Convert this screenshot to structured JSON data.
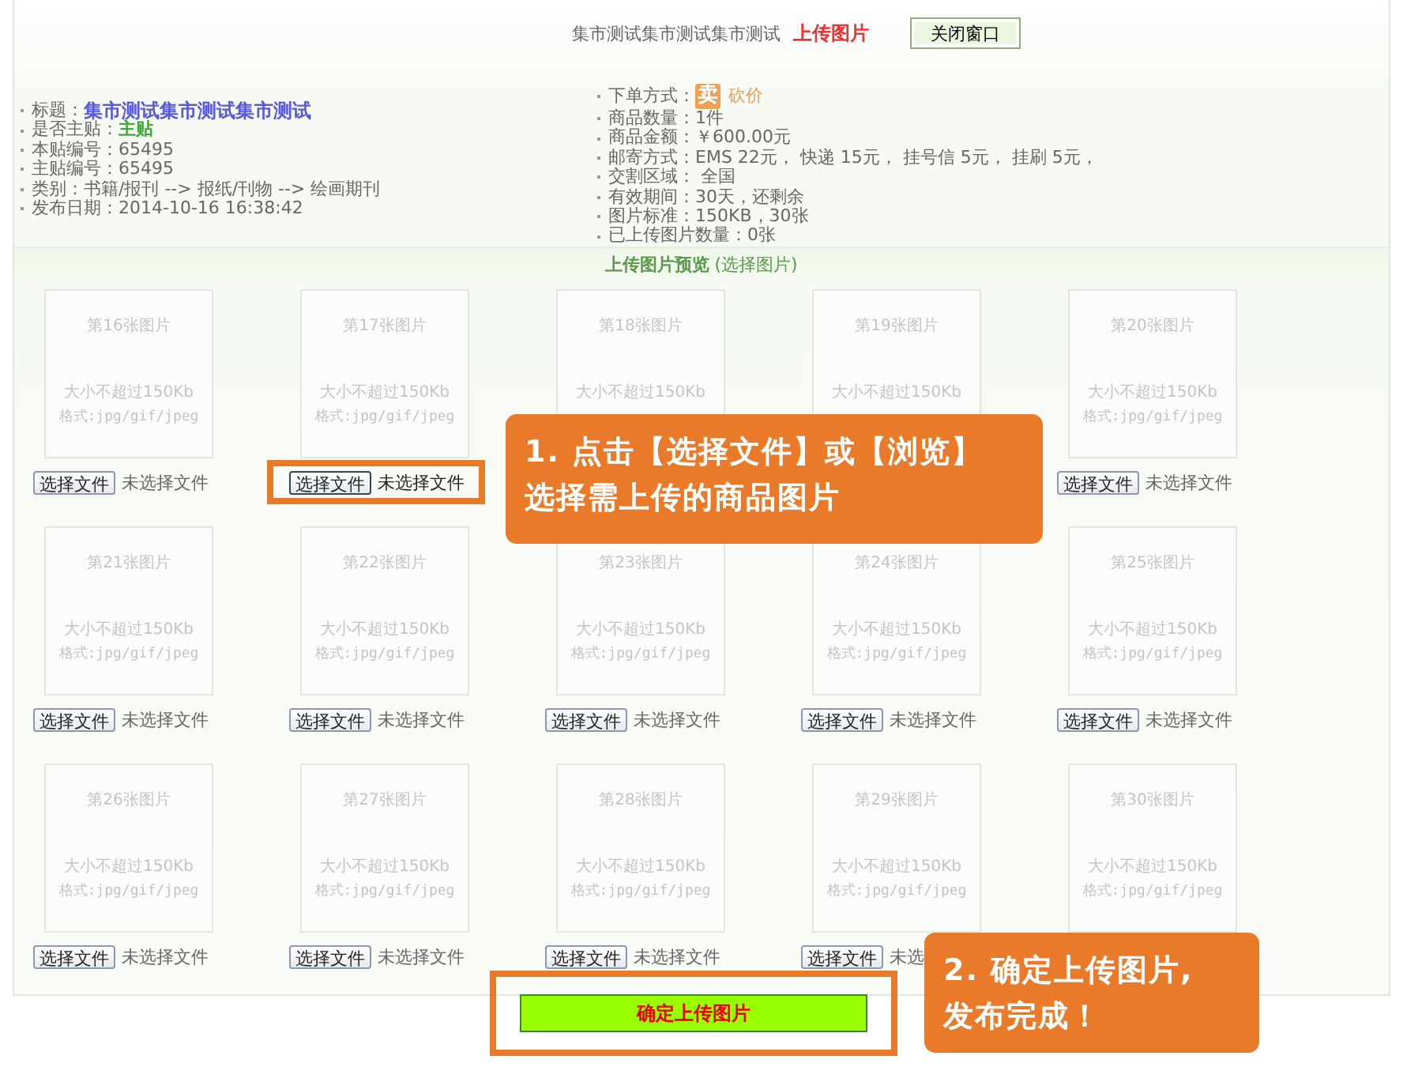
{
  "header": {
    "title": "集市测试集市测试集市测试",
    "action": "上传图片",
    "close_button": "关闭窗口"
  },
  "info_left": [
    {
      "label": "标题：",
      "value": "集市测试集市测试集市测试",
      "kind": "title"
    },
    {
      "label": "是否主贴：",
      "value": "主贴",
      "kind": "flag"
    },
    {
      "label": "本贴编号：",
      "value": "65495",
      "kind": "plain"
    },
    {
      "label": "主贴编号：",
      "value": "65495",
      "kind": "plain"
    },
    {
      "label": "类别：",
      "value": "书籍/报刊 --> 报纸/刊物 --> 绘画期刊",
      "kind": "plain"
    },
    {
      "label": "发布日期：",
      "value": "2014-10-16 16:38:42",
      "kind": "plain"
    }
  ],
  "info_right": [
    {
      "label": "下单方式：",
      "badge": "卖",
      "value": "砍价",
      "kind": "order"
    },
    {
      "label": "商品数量：",
      "value": "1件",
      "kind": "plain"
    },
    {
      "label": "商品金额：",
      "value": "￥600.00元",
      "kind": "plain"
    },
    {
      "label": "邮寄方式：",
      "value": "EMS 22元， 快递 15元， 挂号信 5元， 挂刷 5元，",
      "kind": "plain"
    },
    {
      "label": "交割区域：",
      "value": " 全国",
      "kind": "plain"
    },
    {
      "label": "有效期间：",
      "value": "30天，还剩余",
      "kind": "plain"
    },
    {
      "label": "图片标准：",
      "value": "150KB，30张",
      "kind": "plain"
    },
    {
      "label": "已上传图片数量：",
      "value": "0张",
      "kind": "plain"
    }
  ],
  "preview_header": {
    "title": "上传图片预览",
    "hint": "(选择图片)"
  },
  "cells": [
    {
      "title": "第16张图片",
      "size": "大小不超过150Kb",
      "format": "格式:jpg/gif/jpeg",
      "button": "选择文件",
      "status": "未选择文件",
      "highlighted": false
    },
    {
      "title": "第17张图片",
      "size": "大小不超过150Kb",
      "format": "格式:jpg/gif/jpeg",
      "button": "选择文件",
      "status": "未选择文件",
      "highlighted": true
    },
    {
      "title": "第18张图片",
      "size": "大小不超过150Kb",
      "highlighted": false
    },
    {
      "title": "第19张图片",
      "size": "大小不超过150Kb",
      "highlighted": false
    },
    {
      "title": "第20张图片",
      "size": "大小不超过150Kb",
      "format": "格式:jpg/gif/jpeg",
      "button": "选择文件",
      "status": "未选择文件",
      "highlighted": false
    },
    {
      "title": "第21张图片",
      "size": "大小不超过150Kb",
      "format": "格式:jpg/gif/jpeg",
      "button": "选择文件",
      "status": "未选择文件",
      "highlighted": false
    },
    {
      "title": "第22张图片",
      "size": "大小不超过150Kb",
      "format": "格式:jpg/gif/jpeg",
      "button": "选择文件",
      "status": "未选择文件",
      "highlighted": false
    },
    {
      "title": "第23张图片",
      "size": "大小不超过150Kb",
      "format": "格式:jpg/gif/jpeg",
      "button": "选择文件",
      "status": "未选择文件",
      "highlighted": false
    },
    {
      "title": "第24张图片",
      "size": "大小不超过150Kb",
      "format": "格式:jpg/gif/jpeg",
      "button": "选择文件",
      "status": "未选择文件",
      "highlighted": false
    },
    {
      "title": "第25张图片",
      "size": "大小不超过150Kb",
      "format": "格式:jpg/gif/jpeg",
      "button": "选择文件",
      "status": "未选择文件",
      "highlighted": false
    },
    {
      "title": "第26张图片",
      "size": "大小不超过150Kb",
      "format": "格式:jpg/gif/jpeg",
      "button": "选择文件",
      "status": "未选择文件",
      "highlighted": false
    },
    {
      "title": "第27张图片",
      "size": "大小不超过150Kb",
      "format": "格式:jpg/gif/jpeg",
      "button": "选择文件",
      "status": "未选择文件",
      "highlighted": false
    },
    {
      "title": "第28张图片",
      "size": "大小不超过150Kb",
      "format": "格式:jpg/gif/jpeg",
      "button": "选择文件",
      "status": "未选择文件",
      "highlighted": false
    },
    {
      "title": "第29张图片",
      "size": "大小不超过150Kb",
      "format": "格式:jpg/gif/jpeg",
      "button": "选择文件",
      "status": "未选",
      "highlighted": false
    },
    {
      "title": "第30张图片",
      "size": "大小不超过150Kb",
      "format": "格式:jpg/gif/jpeg",
      "highlighted": false
    }
  ],
  "confirm_button": "确定上传图片",
  "callouts": [
    {
      "lines": [
        "1. 点击【选择文件】或【浏览】",
        "选择需上传的商品图片"
      ]
    },
    {
      "lines": [
        "2. 确定上传图片,",
        "发布完成！"
      ]
    }
  ]
}
